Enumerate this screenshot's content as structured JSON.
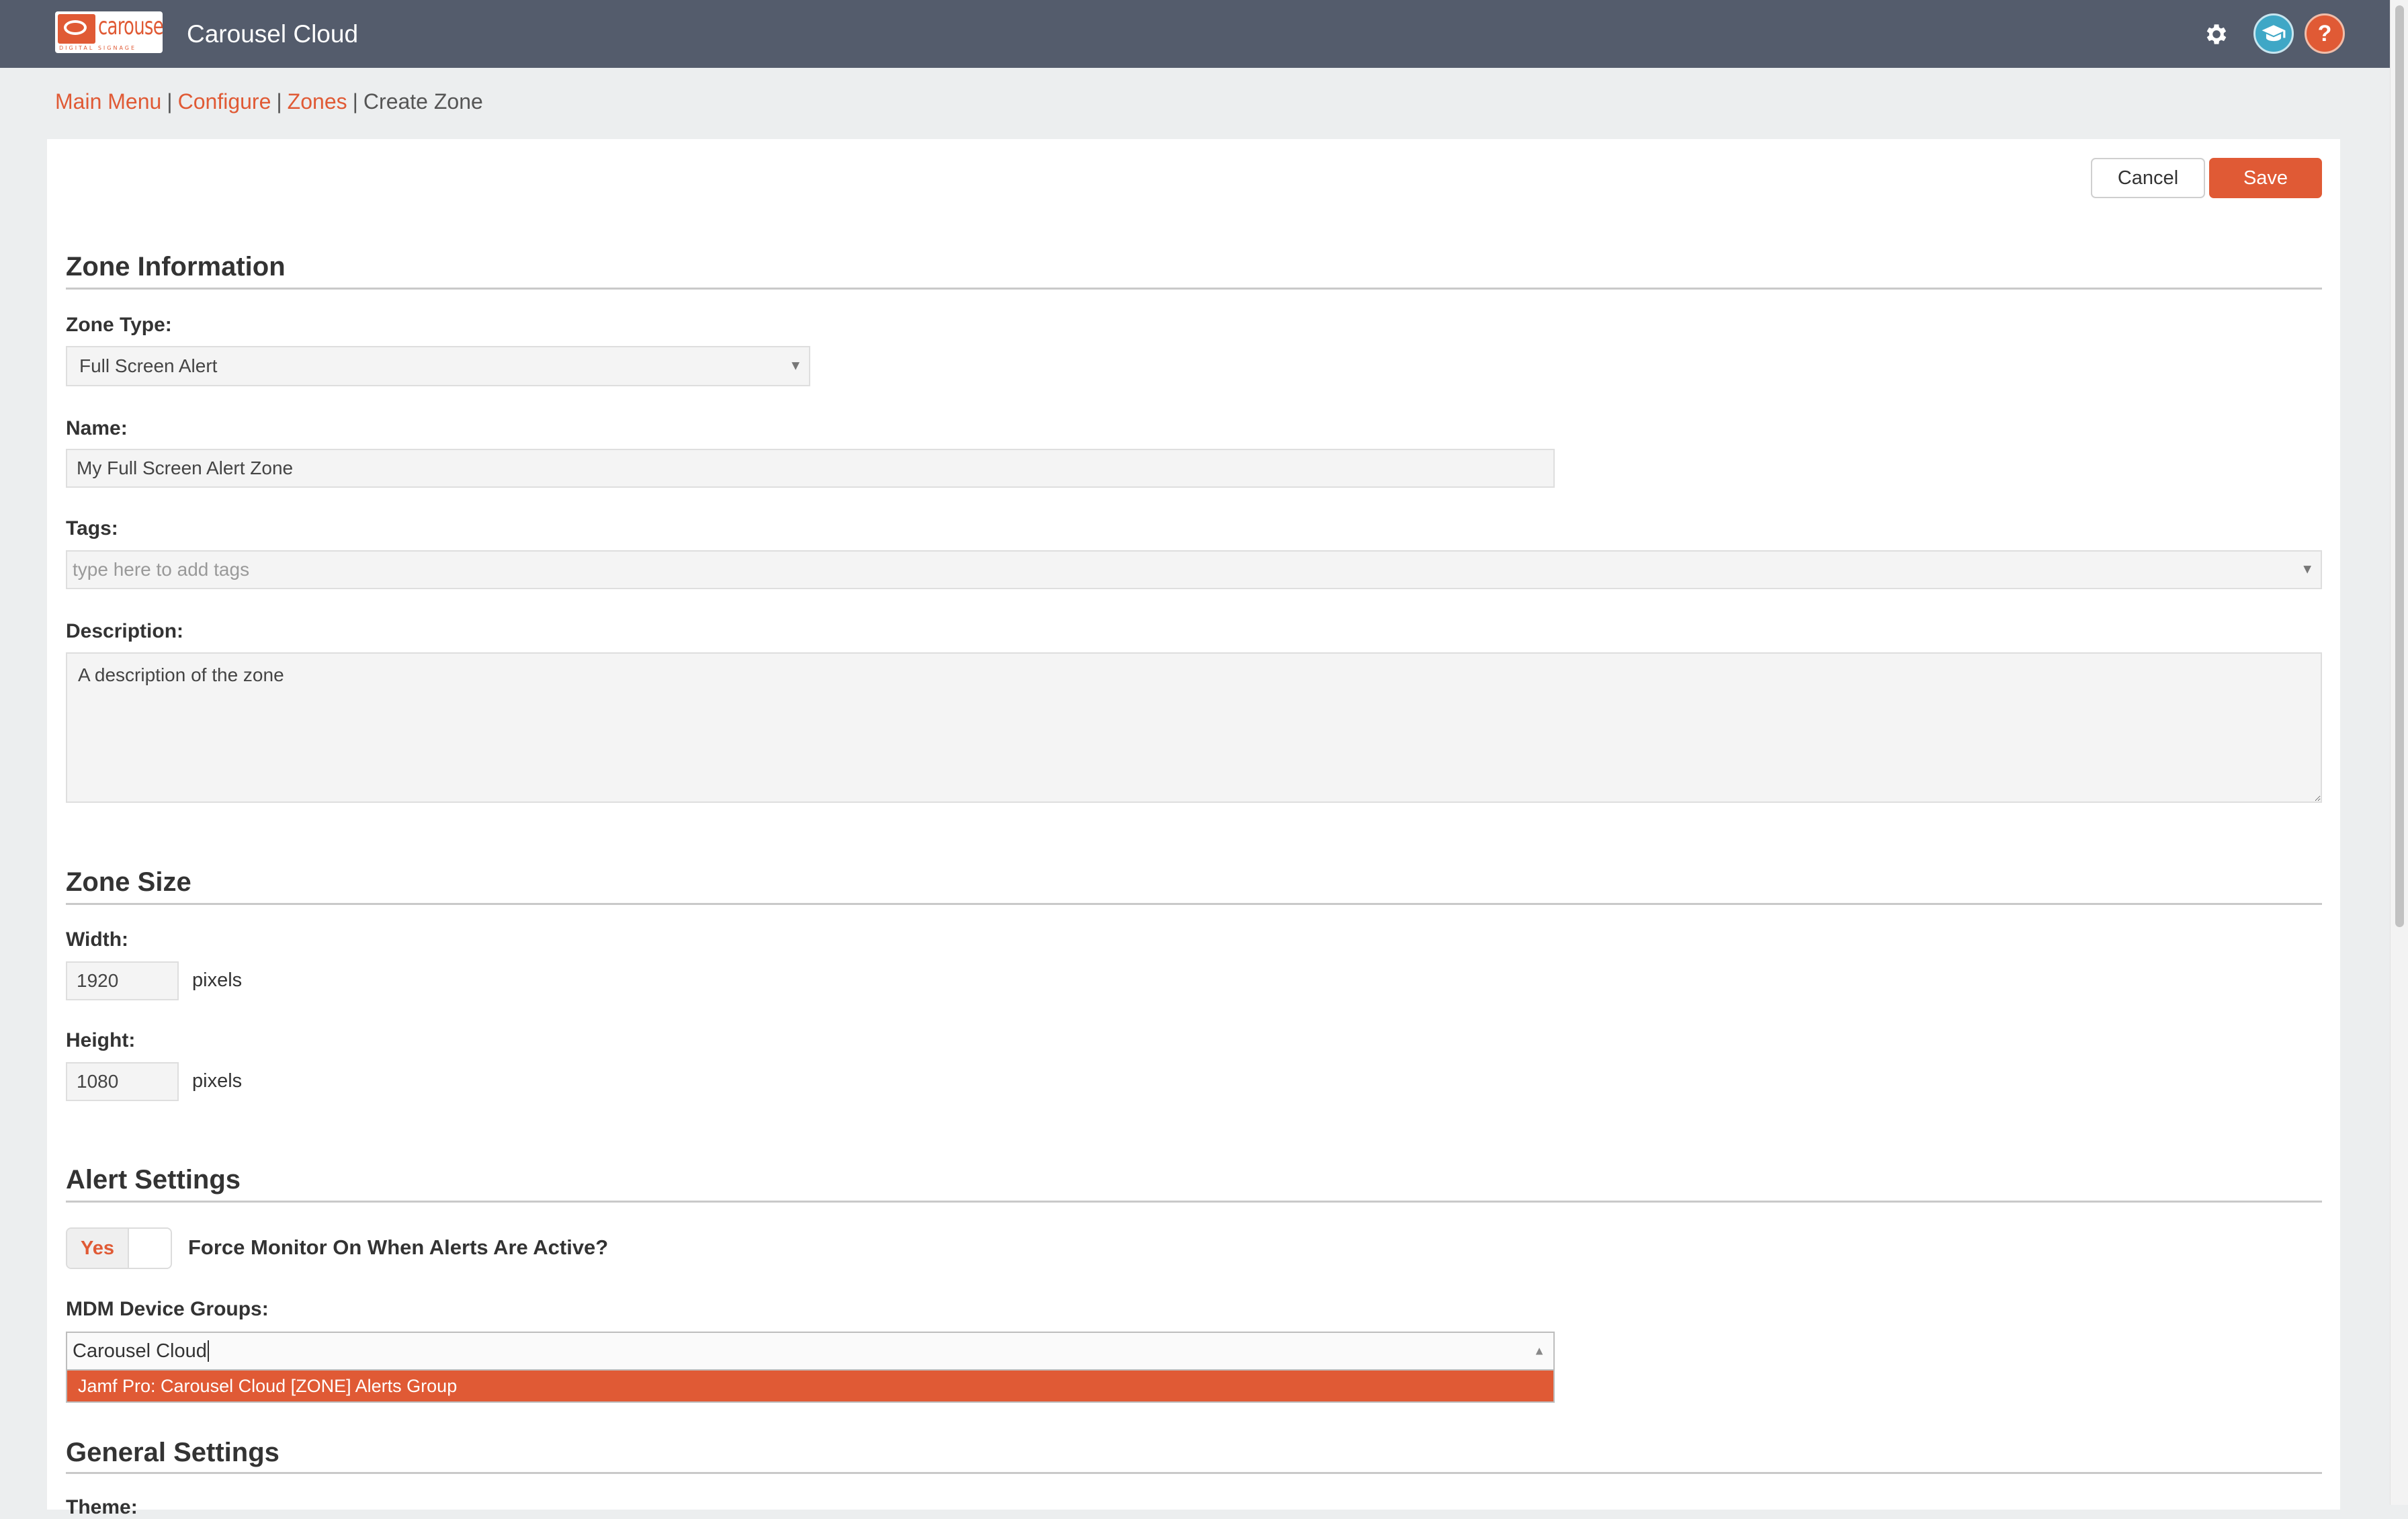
{
  "app": {
    "title": "Carousel Cloud",
    "logo_word": "carousel",
    "logo_sub": "DIGITAL SIGNAGE"
  },
  "topbar": {
    "settings_icon": "gear-icon",
    "training_icon": "graduation-cap-icon",
    "help_icon": "question-mark-icon",
    "help_glyph": "?"
  },
  "breadcrumb": {
    "items": [
      "Main Menu",
      "Configure",
      "Zones"
    ],
    "separator": "|",
    "current": "Create Zone"
  },
  "actions": {
    "cancel_label": "Cancel",
    "save_label": "Save"
  },
  "sections": {
    "zone_information": "Zone Information",
    "zone_size": "Zone Size",
    "alert_settings": "Alert Settings",
    "general_settings": "General Settings"
  },
  "zone_info": {
    "zone_type_label": "Zone Type:",
    "zone_type_value": "Full Screen Alert",
    "name_label": "Name:",
    "name_value": "My Full Screen Alert Zone",
    "tags_label": "Tags:",
    "tags_placeholder": "type here to add tags",
    "description_label": "Description:",
    "description_value": "A description of the zone"
  },
  "zone_size": {
    "width_label": "Width:",
    "width_value": "1920",
    "height_label": "Height:",
    "height_value": "1080",
    "unit": "pixels"
  },
  "alert_settings": {
    "force_monitor_toggle": "Yes",
    "force_monitor_label": "Force Monitor On When Alerts Are Active?",
    "mdm_label": "MDM Device Groups:",
    "mdm_input_value": "Carousel Cloud",
    "mdm_options": [
      "Jamf Pro: Carousel Cloud [ZONE] Alerts Group"
    ]
  },
  "general_settings": {
    "first_label": "Theme:"
  },
  "colors": {
    "accent": "#e05a35",
    "topbar": "#545c6c",
    "page_bg": "#eceeef",
    "training_icon": "#3fa7c6"
  }
}
